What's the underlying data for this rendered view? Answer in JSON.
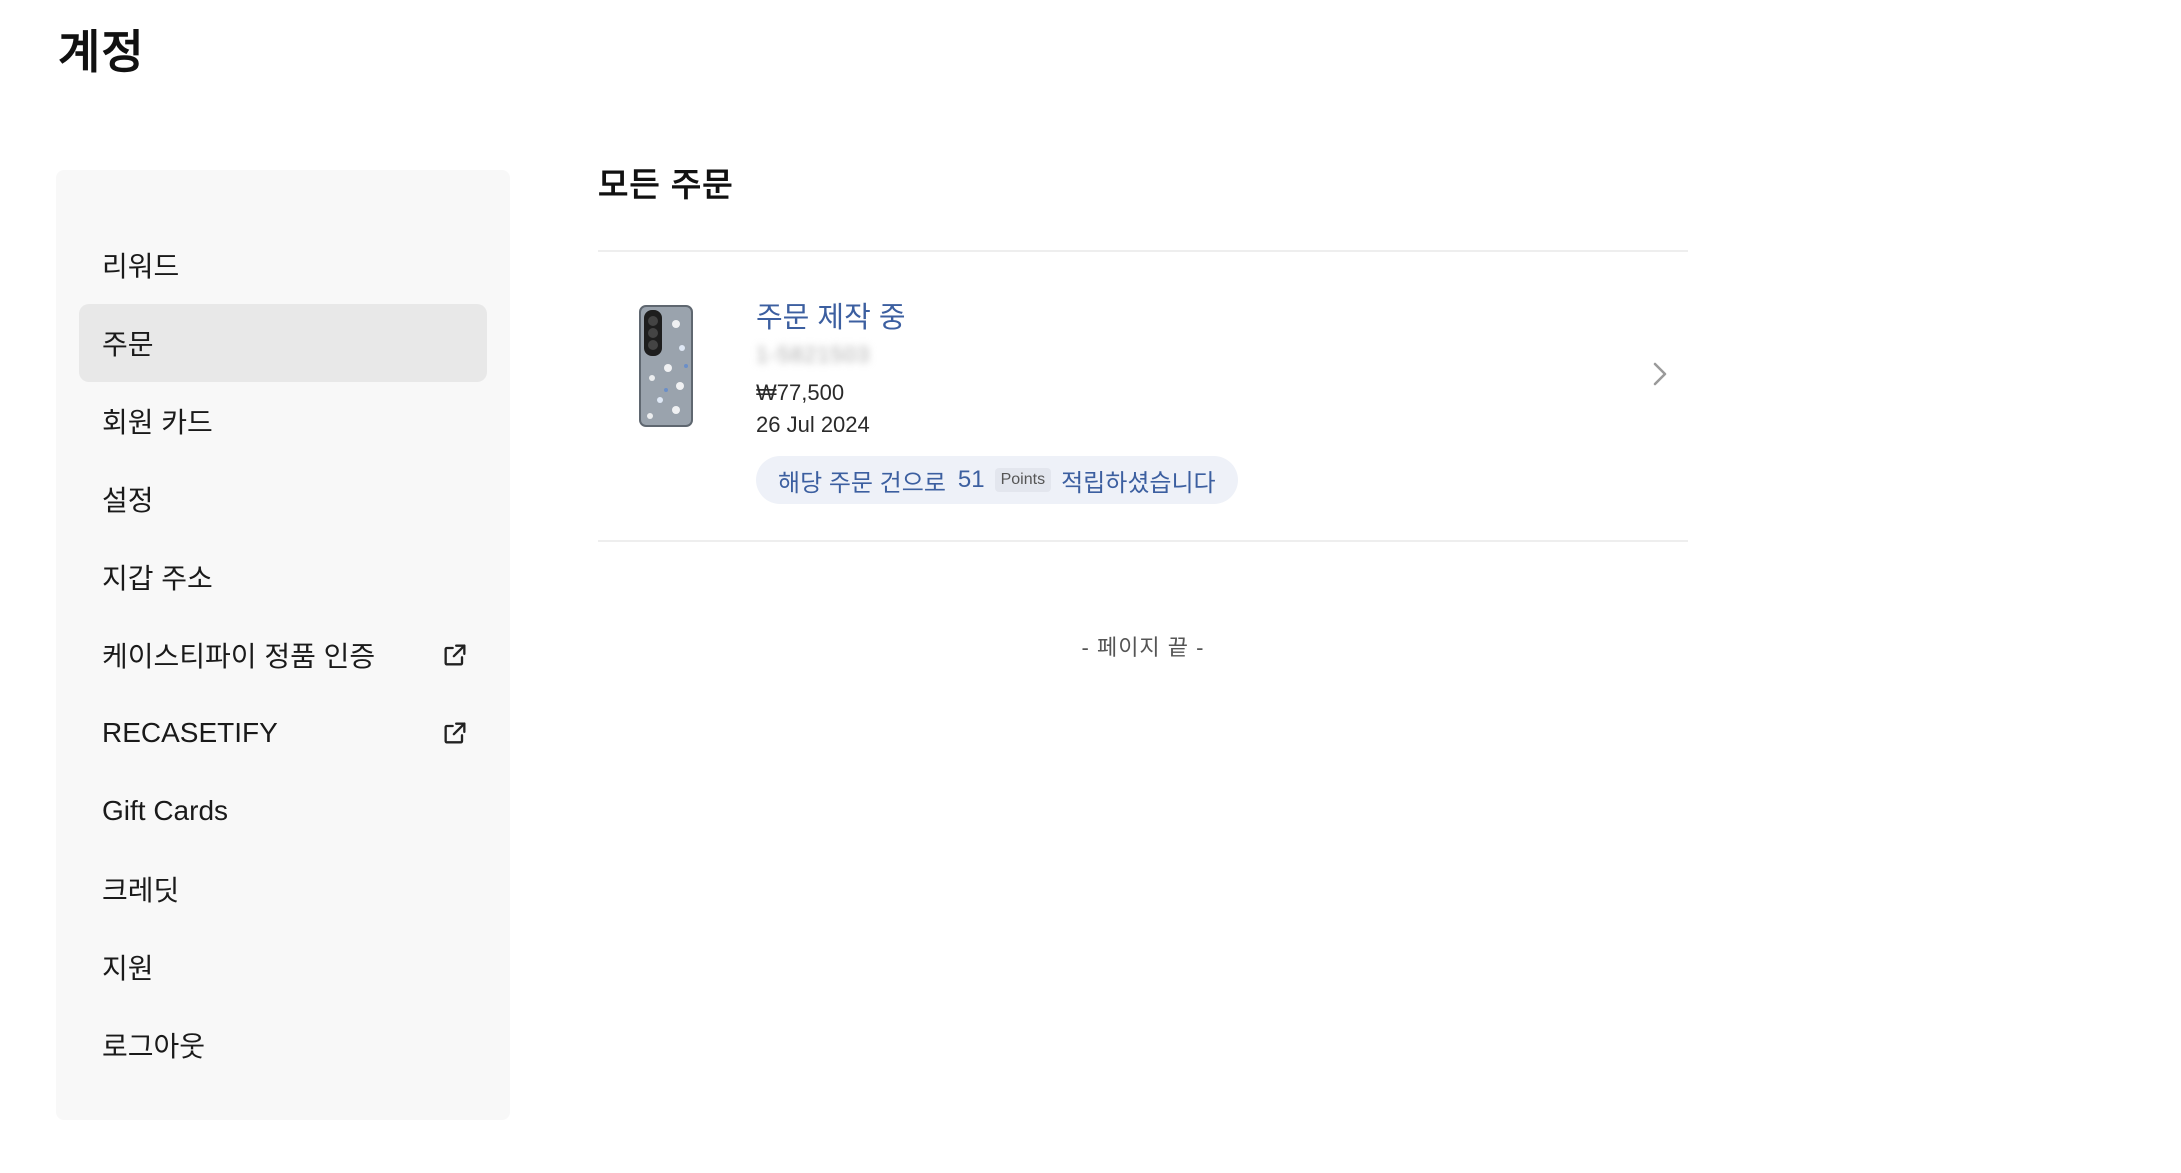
{
  "page": {
    "title": "계정"
  },
  "sidebar": {
    "items": [
      {
        "label": "리워드"
      },
      {
        "label": "주문"
      },
      {
        "label": "회원 카드"
      },
      {
        "label": "설정"
      },
      {
        "label": "지갑 주소"
      },
      {
        "label": "케이스티파이 정품 인증",
        "icon": "external-link-icon"
      },
      {
        "label": "RECASETIFY",
        "icon": "external-link-icon"
      },
      {
        "label": "Gift Cards"
      },
      {
        "label": "크레딧"
      },
      {
        "label": "지원"
      },
      {
        "label": "로그아웃"
      }
    ],
    "active_item": "주문"
  },
  "main": {
    "section_title": "모든 주문",
    "orders": [
      {
        "status": "주문 제작 중",
        "order_number": "1-5821503",
        "price": "₩77,500",
        "date": "26 Jul 2024",
        "points": {
          "prefix": "해당 주문 건으로",
          "amount": "51",
          "unit": "Points",
          "suffix": "적립하셨습니다"
        },
        "thumbnail": "phone-case-thumbnail",
        "chevron": "chevron-right-icon"
      }
    ],
    "end_of_page": "- 페이지 끝 -"
  },
  "colors": {
    "status_blue": "#3c5fa0",
    "pill_bg": "#eef1f8",
    "sidebar_bg": "#f8f8f8",
    "active_item_bg": "#e8e8e8"
  }
}
